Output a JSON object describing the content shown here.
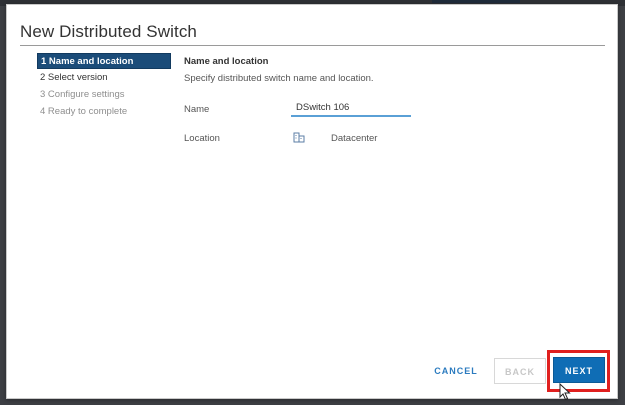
{
  "dialog": {
    "title": "New Distributed Switch"
  },
  "steps": [
    {
      "label": "1 Name and location",
      "state": "active"
    },
    {
      "label": "2 Select version",
      "state": "enabled"
    },
    {
      "label": "3 Configure settings",
      "state": "disabled"
    },
    {
      "label": "4 Ready to complete",
      "state": "disabled"
    }
  ],
  "content": {
    "heading": "Name and location",
    "subtitle": "Specify distributed switch name and location.",
    "name_label": "Name",
    "name_value": "DSwitch 106",
    "location_label": "Location",
    "location_icon": "datacenter-icon",
    "location_value": "Datacenter"
  },
  "buttons": {
    "cancel": "CANCEL",
    "back": "BACK",
    "next": "NEXT"
  },
  "colors": {
    "active_step": "#1b4c79",
    "primary": "#0f6db5",
    "highlight": "#e0201f"
  }
}
